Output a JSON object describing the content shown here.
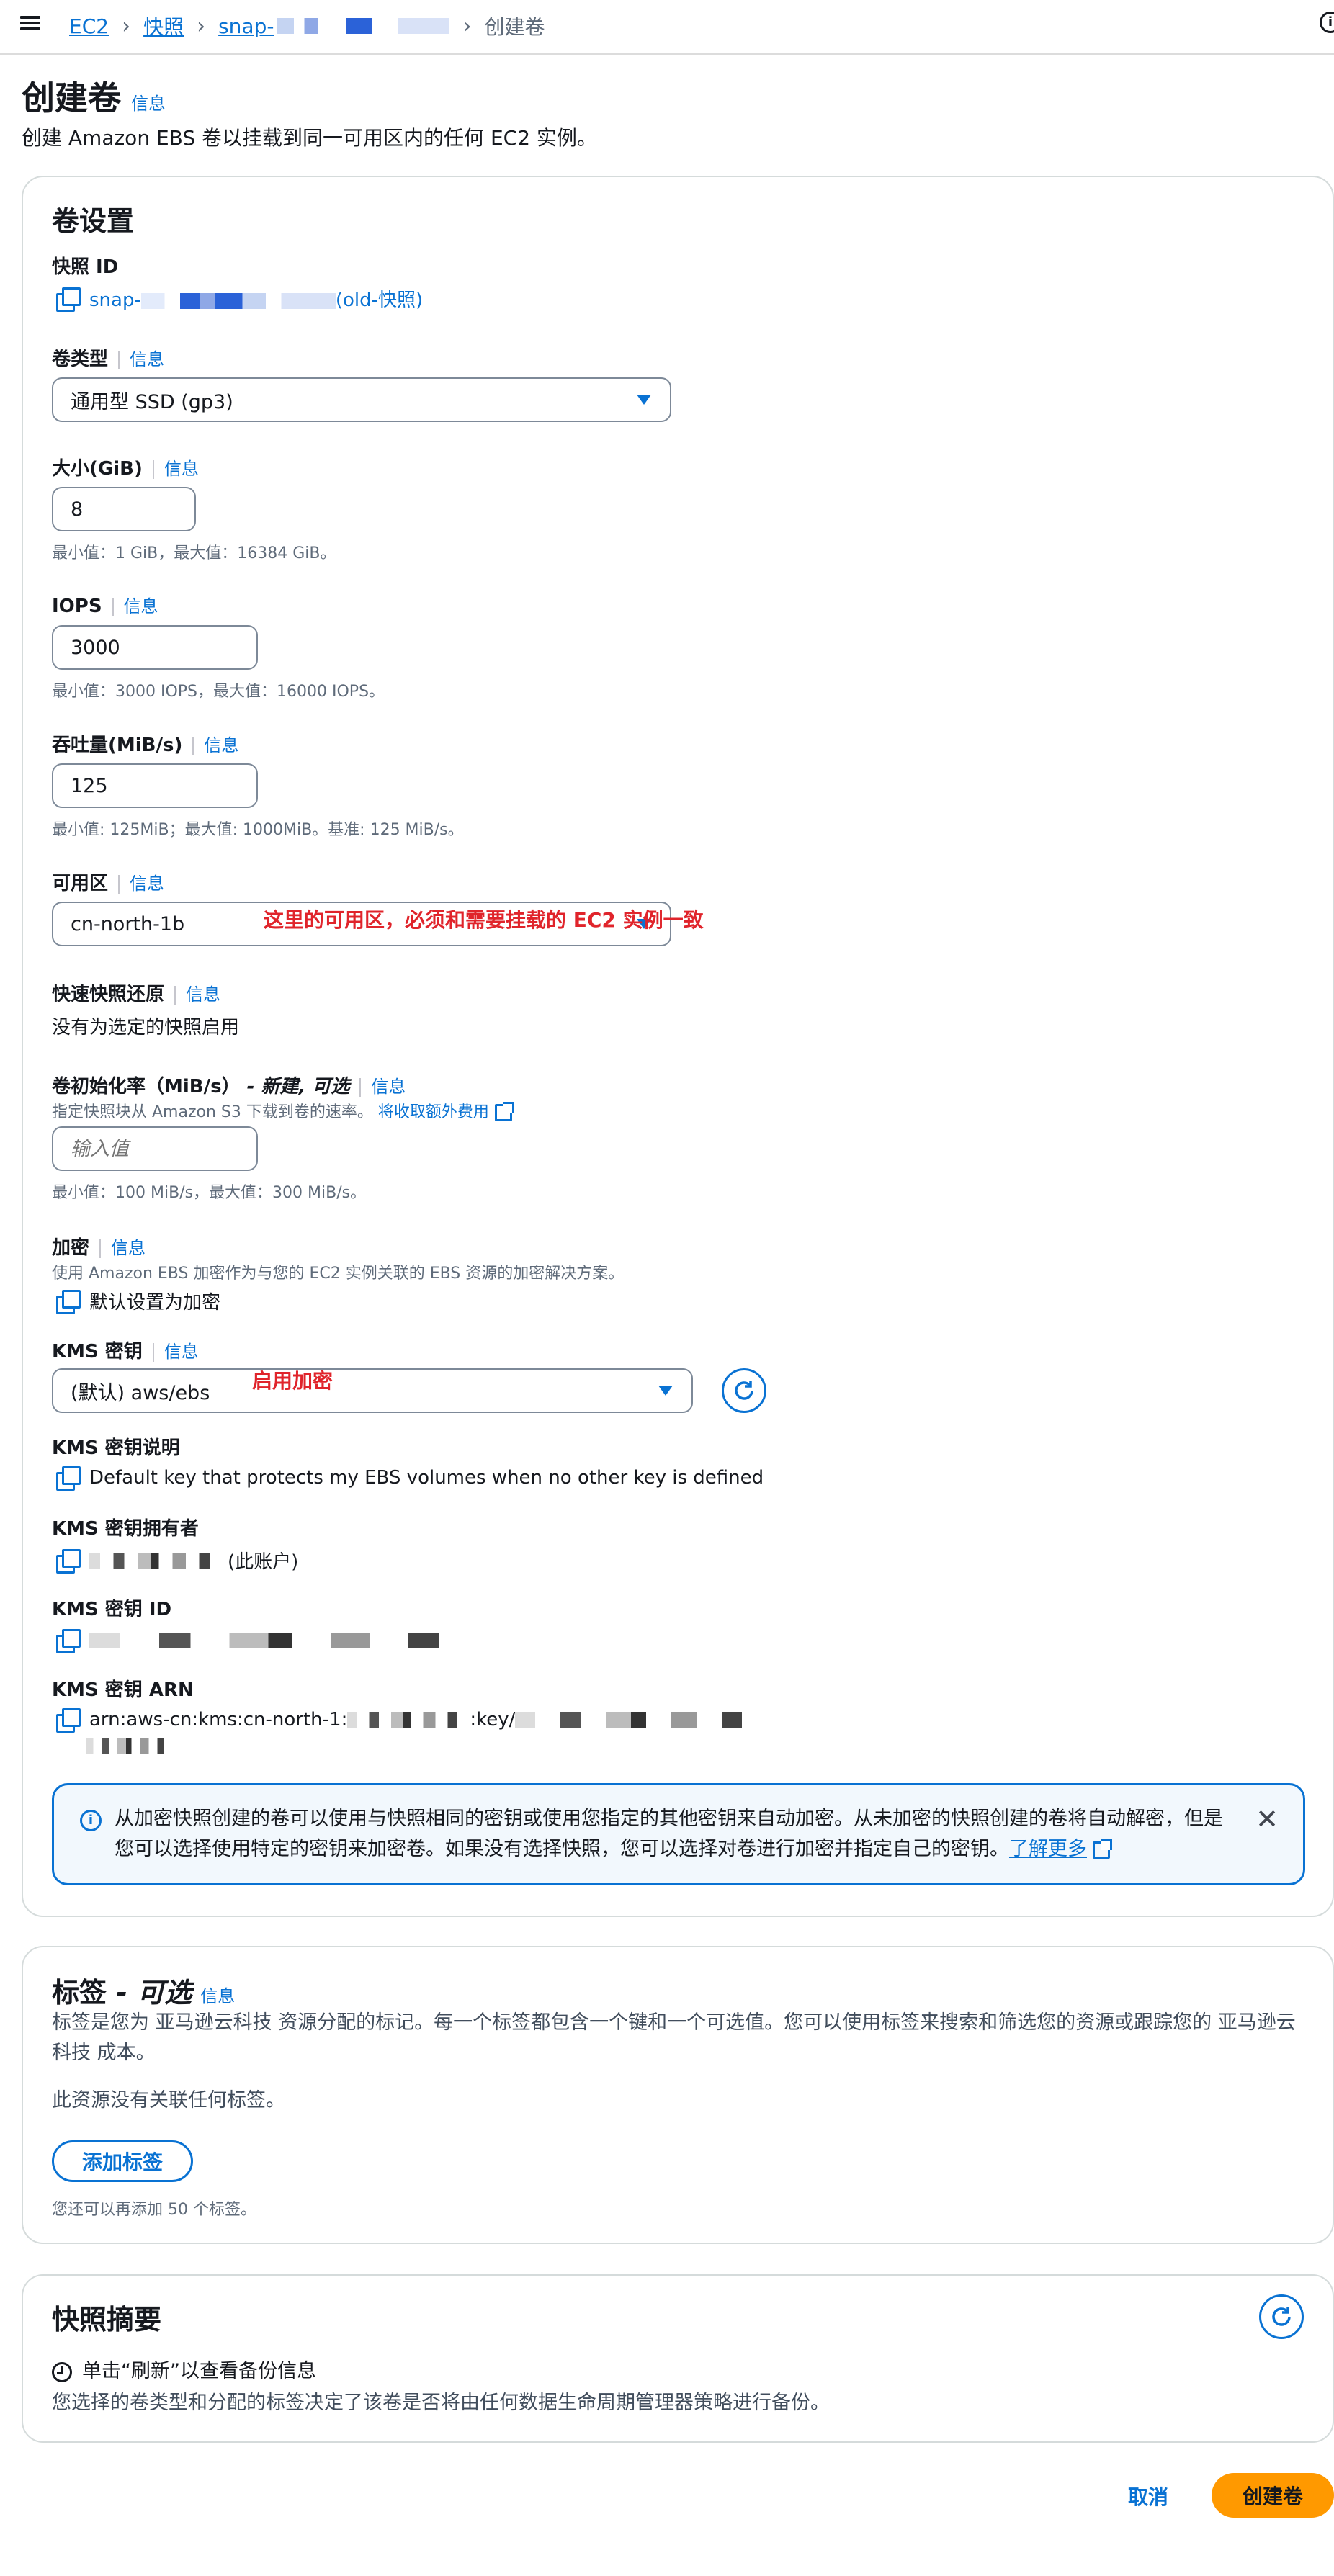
{
  "breadcrumb": {
    "ec2": "EC2",
    "snapshots": "快照",
    "snapshot_prefix": "snap-",
    "current": "创建卷"
  },
  "header": {
    "title": "创建卷",
    "info": "信息",
    "description": "创建 Amazon EBS 卷以挂载到同一可用区内的任何 EC2 实例。"
  },
  "settings": {
    "title": "卷设置",
    "snapshot_id": {
      "label": "快照 ID",
      "prefix": "snap-",
      "suffix": "(old-快照)"
    },
    "volume_type": {
      "label": "卷类型",
      "info": "信息",
      "value": "通用型 SSD (gp3)"
    },
    "size": {
      "label": "大小(GiB)",
      "info": "信息",
      "value": "8",
      "hint": "最小值：1 GiB，最大值：16384 GiB。"
    },
    "iops": {
      "label": "IOPS",
      "info": "信息",
      "value": "3000",
      "hint": "最小值：3000 IOPS，最大值：16000 IOPS。"
    },
    "throughput": {
      "label": "吞吐量(MiB/s)",
      "info": "信息",
      "value": "125",
      "hint": "最小值: 125MiB；最大值: 1000MiB。基准: 125 MiB/s。"
    },
    "az": {
      "label": "可用区",
      "info": "信息",
      "value": "cn-north-1b",
      "annotation": "这里的可用区，必须和需要挂载的 EC2 实例一致"
    },
    "fast_restore": {
      "label": "快速快照还原",
      "info": "信息",
      "value": "没有为选定的快照启用"
    },
    "init_rate": {
      "label": "卷初始化率（MiB/s）",
      "optional": " - 新建, 可选",
      "info": "信息",
      "hint": "指定快照块从 Amazon S3 下载到卷的速率。",
      "hint_link": "将收取额外费用",
      "placeholder": "输入值",
      "range": "最小值：100 MiB/s，最大值：300 MiB/s。"
    },
    "encryption": {
      "label": "加密",
      "info": "信息",
      "hint": "使用 Amazon EBS 加密作为与您的 EC2 实例关联的 EBS 资源的加密解决方案。",
      "value": "默认设置为加密"
    },
    "kms_key": {
      "label": "KMS 密钥",
      "info": "信息",
      "value": "(默认) aws/ebs",
      "annotation": "启用加密"
    },
    "kms_desc": {
      "label": "KMS 密钥说明",
      "value": "Default key that protects my EBS volumes when no other key is defined"
    },
    "kms_owner": {
      "label": "KMS 密钥拥有者",
      "suffix": "(此账户)"
    },
    "kms_id": {
      "label": "KMS 密钥 ID"
    },
    "kms_arn": {
      "label": "KMS 密钥 ARN",
      "prefix": "arn:aws-cn:kms:cn-north-1:",
      "mid": ":key/"
    }
  },
  "alert": {
    "text": "从加密快照创建的卷可以使用与快照相同的密钥或使用您指定的其他密钥来自动加密。从未加密的快照创建的卷将自动解密，但是您可以选择使用特定的密钥来加密卷。如果没有选择快照，您可以选择对卷进行加密并指定自己的密钥。",
    "link": "了解更多"
  },
  "tags": {
    "title": "标签",
    "optional": " - 可选",
    "info": "信息",
    "description": "标签是您为 亚马逊云科技 资源分配的标记。每一个标签都包含一个键和一个可选值。您可以使用标签来搜索和筛选您的资源或跟踪您的 亚马逊云科技 成本。",
    "empty": "此资源没有关联任何标签。",
    "add_button": "添加标签",
    "remaining": "您还可以再添加 50 个标签。"
  },
  "summary": {
    "title": "快照摘要",
    "refresh_hint": "单击“刷新”以查看备份信息",
    "description": "您选择的卷类型和分配的标签决定了该卷是否将由任何数据生命周期管理器策略进行备份。"
  },
  "footer": {
    "cancel": "取消",
    "create": "创建卷"
  },
  "colors": {
    "accent": "#0972d3",
    "primary_button": "#ff9900",
    "annotation": "#e0242b"
  }
}
